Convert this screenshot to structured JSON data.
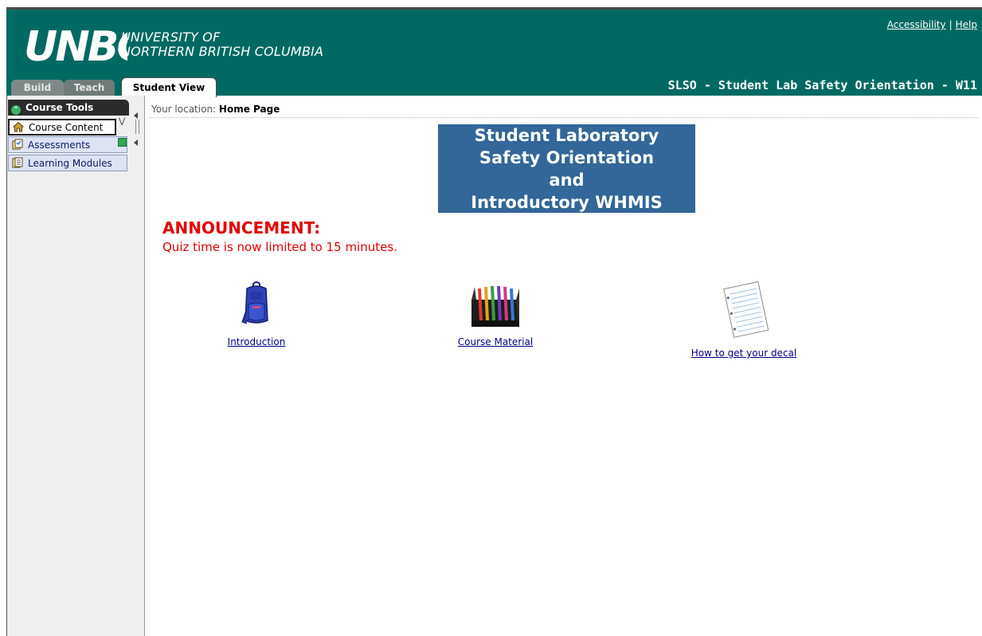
{
  "header": {
    "logo_text": "UNBC",
    "university_line1": "UNIVERSITY OF",
    "university_line2": "NORTHERN BRITISH COLUMBIA",
    "accessibility_link": "Accessibility",
    "separator": "|",
    "help_link": "Help",
    "course_title": "SLSO - Student Lab Safety Orientation - W11"
  },
  "tabs": [
    {
      "label": "Build"
    },
    {
      "label": "Teach"
    },
    {
      "label": "Student View"
    }
  ],
  "sidebar": {
    "title": "Course Tools",
    "items": [
      {
        "label": "Course Content",
        "icon": "home-icon"
      },
      {
        "label": "Assessments",
        "icon": "assessment-icon"
      },
      {
        "label": "Learning Modules",
        "icon": "module-icon"
      }
    ]
  },
  "location": {
    "prefix": "Your location:",
    "page": "Home Page"
  },
  "banner": {
    "line1": "Student Laboratory",
    "line2": "Safety Orientation",
    "line3": "and",
    "line4": "Introductory WHMIS"
  },
  "announcement": {
    "heading": "ANNOUNCEMENT:",
    "text": "Quiz time is now limited to 15 minutes."
  },
  "tiles": [
    {
      "label": "Introduction",
      "icon": "backpack-icon"
    },
    {
      "label": "Course Material",
      "icon": "file-folders-icon"
    },
    {
      "label": "How to get your decal",
      "icon": "notebook-paper-icon"
    }
  ],
  "colors": {
    "header_bg": "#006a62",
    "banner_bg": "#336699",
    "announcement": "#e30000",
    "link": "#00008b"
  }
}
